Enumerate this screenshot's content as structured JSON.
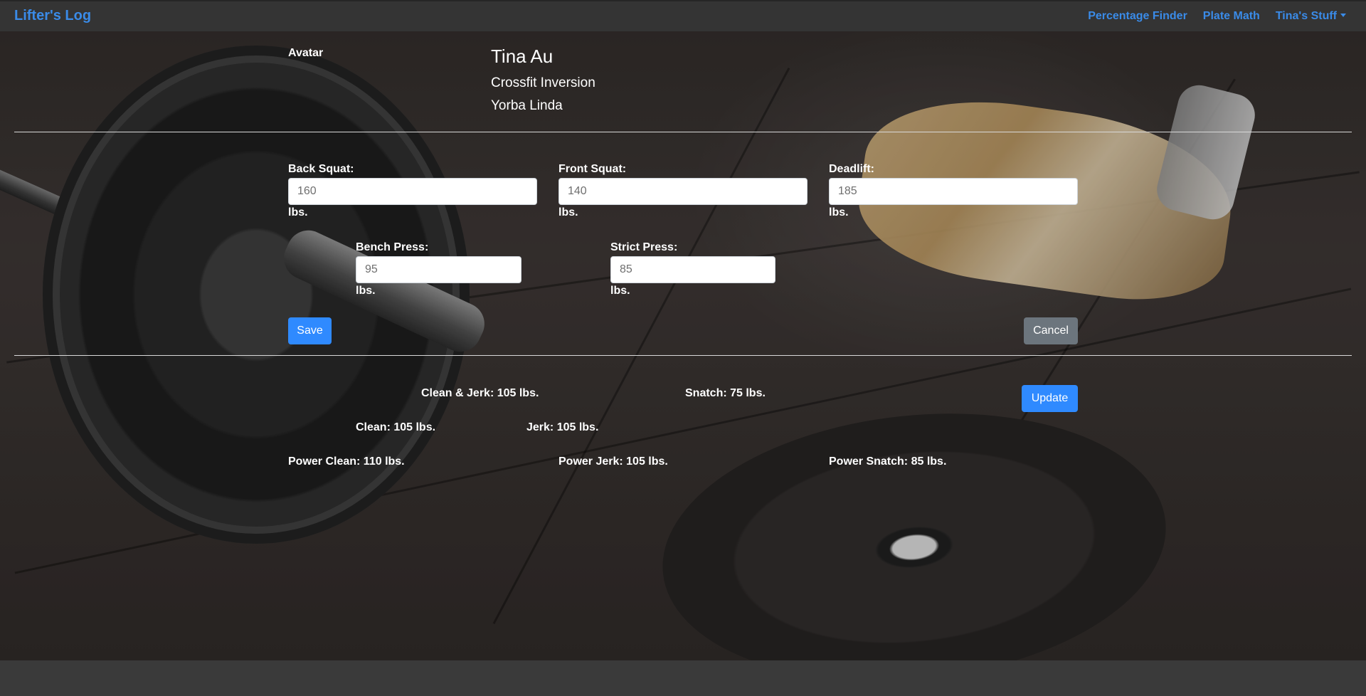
{
  "navbar": {
    "brand": "Lifter's Log",
    "links": [
      {
        "label": "Percentage Finder"
      },
      {
        "label": "Plate Math"
      },
      {
        "label": "Tina's Stuff"
      }
    ]
  },
  "profile": {
    "avatar_label": "Avatar",
    "name": "Tina Au",
    "gym": "Crossfit Inversion",
    "city": "Yorba Linda"
  },
  "strength_form": {
    "unit": "lbs.",
    "back_squat": {
      "label": "Back Squat:",
      "value": "160"
    },
    "front_squat": {
      "label": "Front Squat:",
      "value": "140"
    },
    "deadlift": {
      "label": "Deadlift:",
      "value": "185"
    },
    "bench_press": {
      "label": "Bench Press:",
      "value": "95"
    },
    "strict_press": {
      "label": "Strict Press:",
      "value": "85"
    },
    "save_label": "Save",
    "cancel_label": "Cancel"
  },
  "olympic_lifts": {
    "clean_and_jerk": "Clean & Jerk: 105 lbs.",
    "snatch": "Snatch: 75 lbs.",
    "clean": "Clean: 105 lbs.",
    "jerk": "Jerk: 105 lbs.",
    "power_clean": "Power Clean: 110 lbs.",
    "power_jerk": "Power Jerk: 105 lbs.",
    "power_snatch": "Power Snatch: 85 lbs.",
    "update_label": "Update"
  },
  "colors": {
    "accent": "#2f8aff",
    "link": "#3a8be8",
    "navbar": "#343434",
    "secondary": "#6c757d"
  }
}
